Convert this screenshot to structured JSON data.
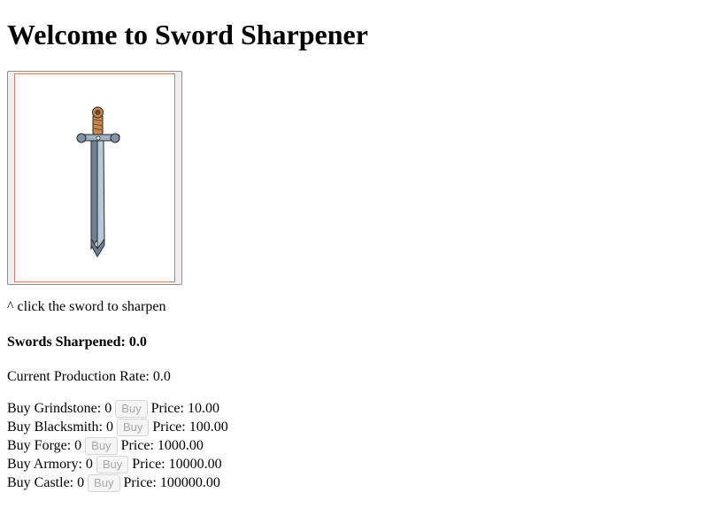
{
  "title": "Welcome to Sword Sharpener",
  "sword": {
    "icon": "sword-icon",
    "colors": {
      "frame_border": "#e07a64",
      "blade_light": "#b8cad9",
      "blade_dark": "#6d7f91",
      "guard": "#7f92a6",
      "grip": "#c8864a",
      "outline": "#2a2a2a"
    }
  },
  "hint": "^ click the sword to sharpen",
  "stats": {
    "swords_sharpened_label": "Swords Sharpened:",
    "swords_sharpened_value": "0.0",
    "production_rate_label": "Current Production Rate:",
    "production_rate_value": "0.0"
  },
  "shop": {
    "items": [
      {
        "label": "Buy Grindstone:",
        "count": "0",
        "button": "Buy",
        "price_label": "Price:",
        "price": "10.00"
      },
      {
        "label": "Buy Blacksmith:",
        "count": "0",
        "button": "Buy",
        "price_label": "Price:",
        "price": "100.00"
      },
      {
        "label": "Buy Forge:",
        "count": "0",
        "button": "Buy",
        "price_label": "Price:",
        "price": "1000.00"
      },
      {
        "label": "Buy Armory:",
        "count": "0",
        "button": "Buy",
        "price_label": "Price:",
        "price": "10000.00"
      },
      {
        "label": "Buy Castle:",
        "count": "0",
        "button": "Buy",
        "price_label": "Price:",
        "price": "100000.00"
      }
    ]
  }
}
